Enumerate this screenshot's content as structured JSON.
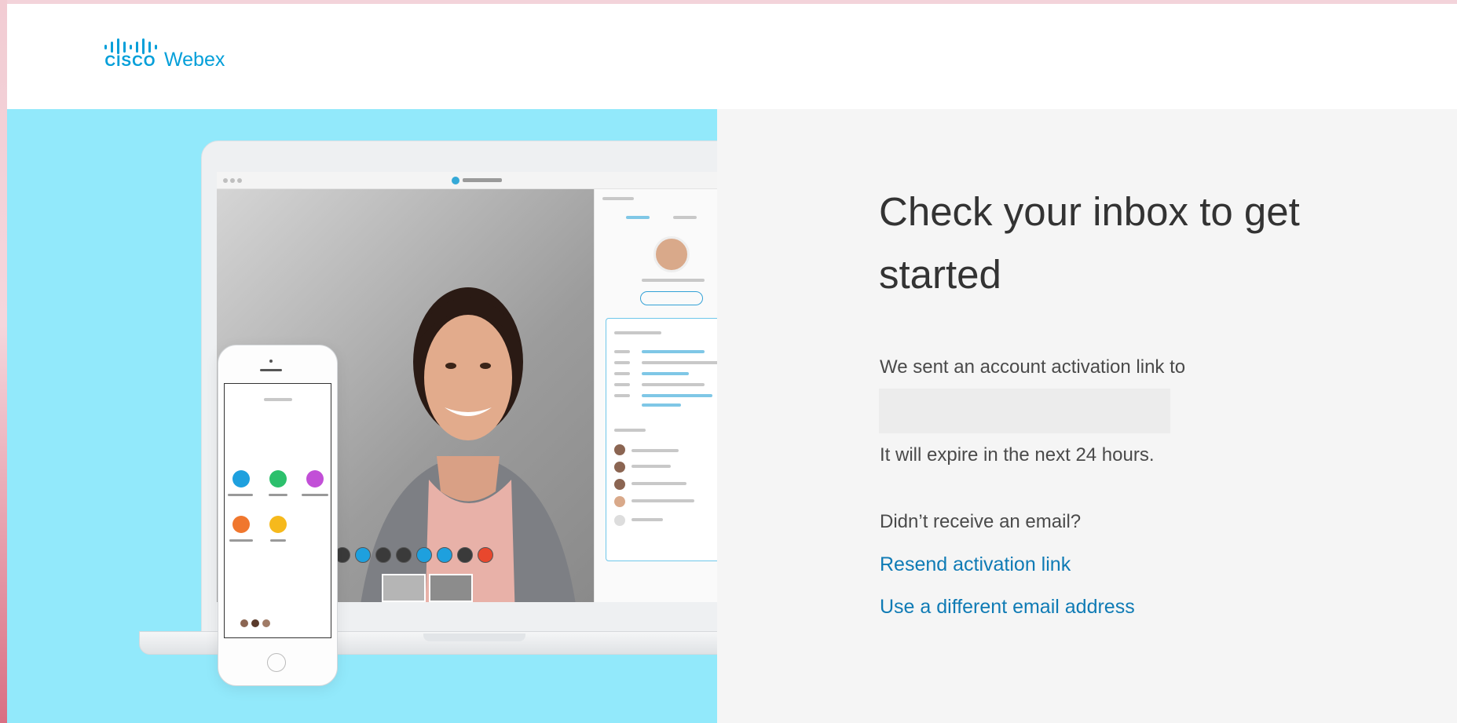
{
  "brand": {
    "company": "CISCO",
    "product": "Webex",
    "color": "#049fd9"
  },
  "panel": {
    "title": "Check your inbox to get started",
    "sent_text": "We sent an account activation link to",
    "email": "",
    "expire_text": "It will expire in the next 24 hours.",
    "not_received_text": "Didn’t receive an email?",
    "resend_link": "Resend activation link",
    "different_email_link": "Use a different email address",
    "link_color": "#0f7bb5"
  },
  "hero": {
    "background_color": "#92e9fb",
    "illustration": "laptop-and-phone-webex-meeting"
  }
}
